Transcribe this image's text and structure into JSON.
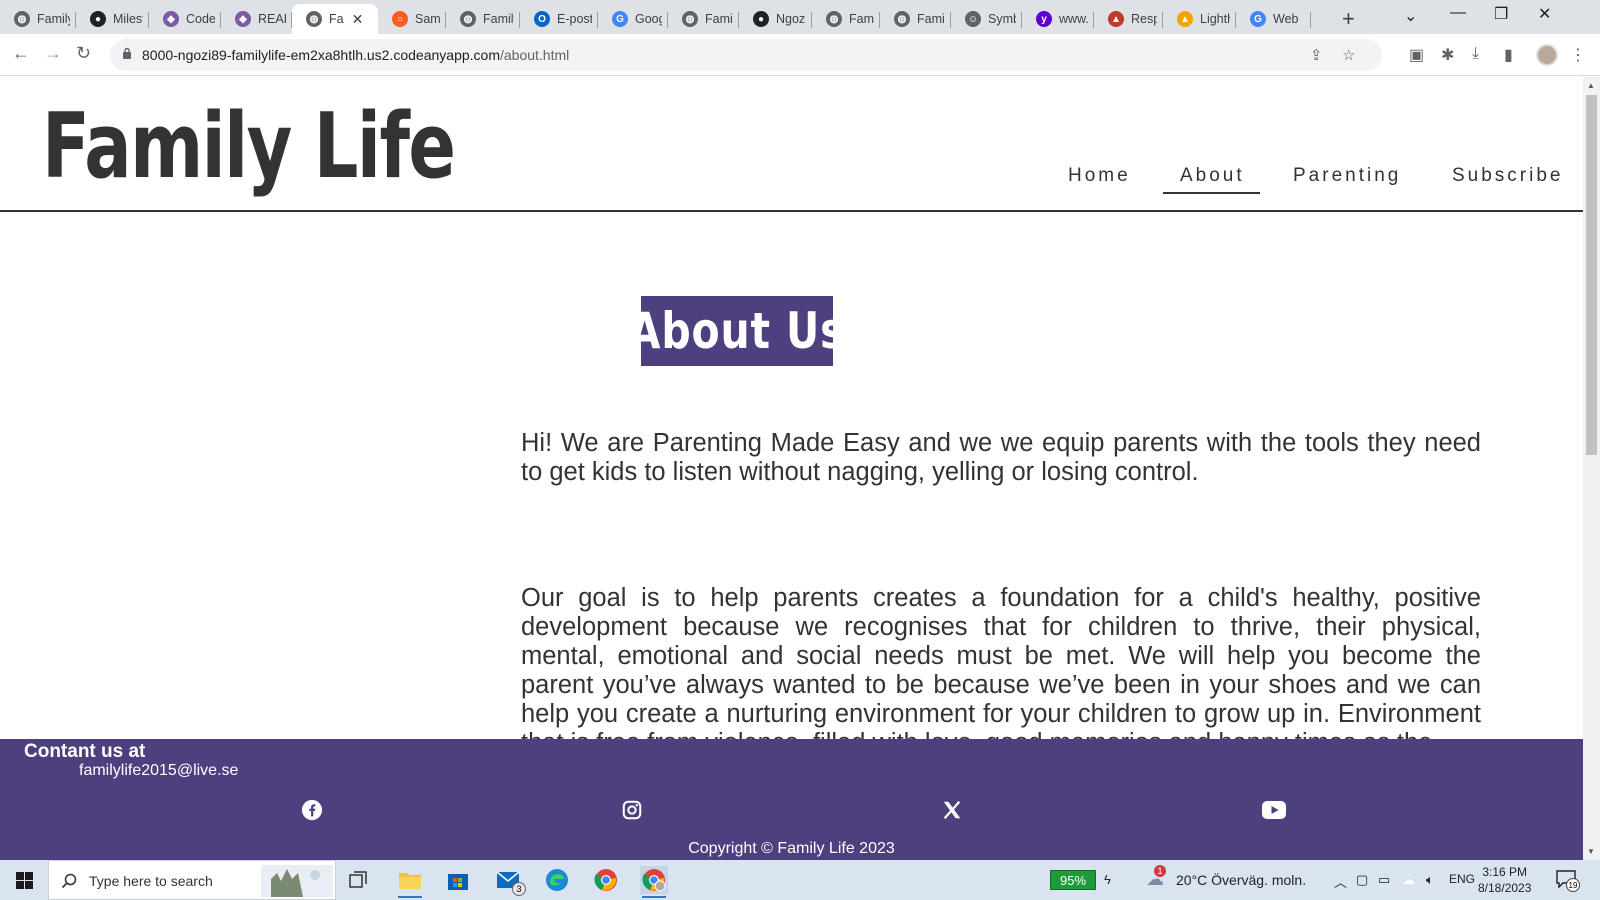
{
  "browser": {
    "tabs": [
      {
        "title": "Family",
        "icon": "globe-icon",
        "color": "#5f6368"
      },
      {
        "title": "Milest",
        "icon": "github-icon",
        "color": "#202124"
      },
      {
        "title": "Codea",
        "icon": "codeanywhere-icon",
        "color": "#7a5aa6"
      },
      {
        "title": "READ",
        "icon": "codeanywhere-icon",
        "color": "#7a5aa6"
      },
      {
        "title": "Fa",
        "icon": "globe-icon",
        "color": "#5f6368",
        "active": true
      },
      {
        "title": "Sampl",
        "icon": "ring-icon",
        "color": "#ff5a1f"
      },
      {
        "title": "Family",
        "icon": "globe-icon",
        "color": "#5f6368"
      },
      {
        "title": "E-post",
        "icon": "outlook-icon",
        "color": "#0a64c8"
      },
      {
        "title": "Googl",
        "icon": "translate-icon",
        "color": "#4285f4"
      },
      {
        "title": "Family",
        "icon": "globe-icon",
        "color": "#5f6368"
      },
      {
        "title": "Ngozi",
        "icon": "github-icon",
        "color": "#202124"
      },
      {
        "title": "Family",
        "icon": "globe-icon",
        "color": "#5f6368"
      },
      {
        "title": "Family",
        "icon": "globe-icon",
        "color": "#5f6368"
      },
      {
        "title": "Symbo",
        "icon": "smiley-icon",
        "color": "#5f6368"
      },
      {
        "title": "www.r",
        "icon": "yahoo-icon",
        "color": "#6001d2"
      },
      {
        "title": "Respo",
        "icon": "responsive-icon",
        "color": "#c0392b"
      },
      {
        "title": "Lighth",
        "icon": "lighthouse-icon",
        "color": "#f4a300"
      },
      {
        "title": "Web",
        "icon": "google-icon",
        "color": "#4285f4"
      }
    ],
    "url_host": "8000-ngozi89-familylife-em2xa8htlh.us2.codeanyapp.com",
    "url_path": "/about.html"
  },
  "site": {
    "logo": "Family Life",
    "nav": [
      {
        "label": "Home",
        "active": false
      },
      {
        "label": "About",
        "active": true
      },
      {
        "label": "Parenting",
        "active": false
      },
      {
        "label": "Subscribe",
        "active": false
      }
    ],
    "heading": "About Us",
    "paragraph1": "Hi! We are Parenting Made Easy and we we equip parents with the tools they need to get kids to listen without nagging, yelling or losing control.",
    "paragraph2": "Our goal is to help parents creates a foundation for a child's healthy, positive development because we recognises that for children to thrive, their physical, mental, emotional and social needs must be met. We will help you become the parent you’ve always wanted to be because we’ve been in your shoes and we can help you create a nurturing environment for your children to grow up in. Environment that is free from violence, filled with love, good memories and happy times as the",
    "footer": {
      "contact_title": "Contant us at",
      "email": "familylife2015@live.se",
      "social": [
        "facebook-icon",
        "instagram-icon",
        "x-icon",
        "youtube-icon"
      ],
      "copyright": "Copyright © Family Life 2023"
    },
    "accent_color": "#4e3f7f"
  },
  "taskbar": {
    "search_placeholder": "Type here to search",
    "mail_badge": "3",
    "battery": "95%",
    "weather_badge": "1",
    "weather": "20°C  Överväg. moln.",
    "language": "ENG",
    "time": "3:16 PM",
    "date": "8/18/2023",
    "notifications": "19"
  }
}
